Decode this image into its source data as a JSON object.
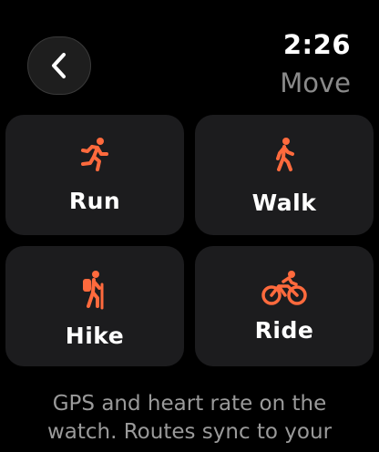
{
  "status": {
    "time": "2:26"
  },
  "header": {
    "title": "Move",
    "back_icon": "chevron-left-icon"
  },
  "tiles": [
    {
      "label": "Run",
      "icon": "running-figure-icon"
    },
    {
      "label": "Walk",
      "icon": "walking-figure-icon"
    },
    {
      "label": "Hike",
      "icon": "hiking-figure-icon"
    },
    {
      "label": "Ride",
      "icon": "cycling-figure-icon"
    }
  ],
  "footer": {
    "line1": "GPS and heart rate on the",
    "line2": "watch. Routes sync to your"
  },
  "colors": {
    "accent": "#ff6a3d",
    "background": "#000000",
    "tile": "#1c1c1e",
    "secondary_text": "#8a8a8a"
  }
}
